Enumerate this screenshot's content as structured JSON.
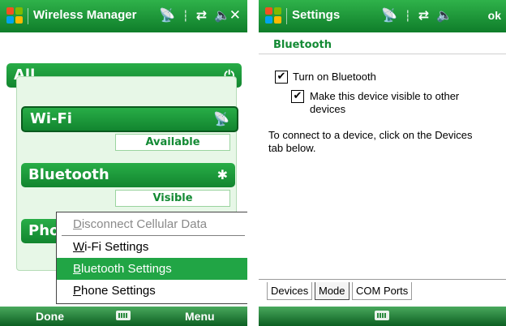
{
  "left": {
    "title": "Wireless Manager",
    "status_icons": [
      "antenna-icon",
      "signal-icon",
      "network-icon",
      "volume-icon"
    ],
    "close_label": "✕",
    "all_label": "All",
    "wifi": {
      "label": "Wi-Fi",
      "status": "Available"
    },
    "bluetooth": {
      "label": "Bluetooth",
      "status": "Visible"
    },
    "phone": {
      "label": "Pho"
    },
    "menu": {
      "items": [
        {
          "label": "Disconnect Cellular Data",
          "accel": "D",
          "rest": "isconnect Cellular Data",
          "disabled": true
        },
        {
          "label": "Wi-Fi Settings",
          "accel": "W",
          "rest": "i-Fi Settings"
        },
        {
          "label": "Bluetooth Settings",
          "accel": "B",
          "rest": "luetooth Settings",
          "highlighted": true
        },
        {
          "label": "Phone Settings",
          "accel": "P",
          "rest": "hone Settings"
        }
      ]
    },
    "softkeys": {
      "left": "Done",
      "right": "Menu"
    }
  },
  "right": {
    "title": "Settings",
    "ok_label": "ok",
    "heading": "Bluetooth",
    "turn_on": "Turn on Bluetooth",
    "visible_line1": "Make this device visible to other",
    "visible_line2": "devices",
    "info_line1": "To connect to a device, click on the Devices",
    "info_line2": "tab below.",
    "tabs": [
      {
        "label": "Devices"
      },
      {
        "label": "Mode",
        "active": true
      },
      {
        "label": "COM Ports"
      }
    ]
  },
  "colors": {
    "accent": "#1f9a3e",
    "highlight": "#21a545"
  }
}
